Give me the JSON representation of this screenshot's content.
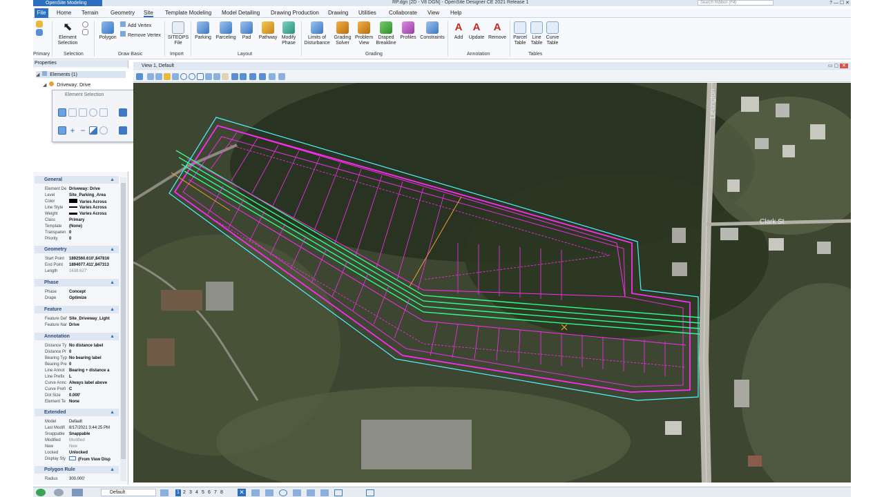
{
  "title_bar": {
    "app_name": "OpenSite Modeling",
    "document": "RP.dgn [2D - V8 DGN] - OpenSite Designer CE 2021 Release 1",
    "search_placeholder": "Search Ribbon (F4)"
  },
  "menu": {
    "file": "File",
    "items": [
      "Home",
      "Terrain",
      "Geometry",
      "Site",
      "Template Modeling",
      "Model Detailing",
      "Drawing Production",
      "Drawing",
      "Utilities",
      "Collaborate",
      "View",
      "Help"
    ],
    "active": "Site"
  },
  "ribbon": {
    "groups": {
      "primary": "Primary",
      "selection": "Selection",
      "draw_basic": "Draw Basic",
      "import": "Import",
      "layout": "Layout",
      "grading": "Grading",
      "annotation": "Annotation",
      "tables": "Tables"
    },
    "tools": {
      "element_selection": "Element Selection",
      "polygon": "Polygon",
      "add_vertex": "Add Vertex",
      "remove_vertex": "Remove Vertex",
      "siteops_file": "SITEOPS File",
      "parking": "Parking",
      "parceling": "Parceling",
      "pad": "Pad",
      "pathway": "Pathway",
      "modify_phase": "Modify Phase",
      "limits_of_disturbance": "Limits of Disturbance",
      "grading_solver": "Grading Solver",
      "problem_view": "Problem View",
      "draped_breakline": "Draped Breakline",
      "profiles": "Profiles",
      "constraints": "Constraints",
      "add": "Add",
      "update": "Update",
      "remove": "Remove",
      "parcel_table": "Parcel Table",
      "line_table": "Line Table",
      "curve_table": "Curve Table"
    }
  },
  "properties": {
    "title": "Properties",
    "tree": {
      "elements": "Elements (1)",
      "driveway": "Driveway: Drive"
    },
    "element_selection_title": "Element Selection",
    "sections": {
      "general": "General",
      "geometry": "Geometry",
      "phase": "Phase",
      "feature": "Feature",
      "annotation": "Annotation",
      "extended": "Extended",
      "polygon_rule": "Polygon Rule"
    },
    "general": [
      {
        "k": "Element De",
        "v": "Driveway: Drive"
      },
      {
        "k": "Level",
        "v": "Site_Parking_Area"
      },
      {
        "k": "Color",
        "v": "Varies Across"
      },
      {
        "k": "Line Style",
        "v": "Varies Across"
      },
      {
        "k": "Weight",
        "v": "Varies Across"
      },
      {
        "k": "Class",
        "v": "Primary"
      },
      {
        "k": "Template",
        "v": "(None)"
      },
      {
        "k": "Transparen",
        "v": "0"
      },
      {
        "k": "Priority",
        "v": "0"
      }
    ],
    "geometry": [
      {
        "k": "Start Point",
        "v": "1892560.610',847816"
      },
      {
        "k": "End Point",
        "v": "1894077.411',847313"
      },
      {
        "k": "Length",
        "v": "1638.627'"
      }
    ],
    "phase": [
      {
        "k": "Phase",
        "v": "Concept"
      },
      {
        "k": "Drape",
        "v": "Optimize"
      }
    ],
    "feature": [
      {
        "k": "Feature Def",
        "v": "Site_Driveway_Light"
      },
      {
        "k": "Feature Nar",
        "v": "Drive"
      }
    ],
    "annotation": [
      {
        "k": "Distance Ty",
        "v": "No distance label"
      },
      {
        "k": "Distance Pr",
        "v": "0"
      },
      {
        "k": "Bearing Typ",
        "v": "No bearing label"
      },
      {
        "k": "Bearing Pre",
        "v": "0"
      },
      {
        "k": "Line Annot",
        "v": "Bearing + distance a"
      },
      {
        "k": "Line Prefix",
        "v": "L"
      },
      {
        "k": "Curve Annc",
        "v": "Always label above"
      },
      {
        "k": "Curve Prefi",
        "v": "C"
      },
      {
        "k": "Dot Size",
        "v": "0.000'"
      },
      {
        "k": "Element Te",
        "v": "None"
      }
    ],
    "extended": [
      {
        "k": "Model",
        "v": "Default"
      },
      {
        "k": "Last Modifi",
        "v": "8/17/2021 3:44:25 PM"
      },
      {
        "k": "Snappable",
        "v": "Snappable"
      },
      {
        "k": "Modified",
        "v": "Modified"
      },
      {
        "k": "New",
        "v": "New"
      },
      {
        "k": "Locked",
        "v": "Unlocked"
      },
      {
        "k": "Display Sty",
        "v": "(From View Disp"
      }
    ],
    "polygon_rule": [
      {
        "k": "Radius",
        "v": "300.000'"
      }
    ]
  },
  "view": {
    "title": "View 1, Default",
    "map_labels": {
      "street_1": "Lexington",
      "street_2": "Clark St"
    }
  },
  "status": {
    "level": "Default",
    "view_numbers": [
      "1",
      "2",
      "3",
      "4",
      "5",
      "6",
      "7",
      "8"
    ]
  },
  "colors": {
    "accent": "#2b6fc0",
    "design_magenta": "#ff2bf5",
    "design_green": "#2dff8c",
    "design_cyan": "#4ff4ff"
  }
}
